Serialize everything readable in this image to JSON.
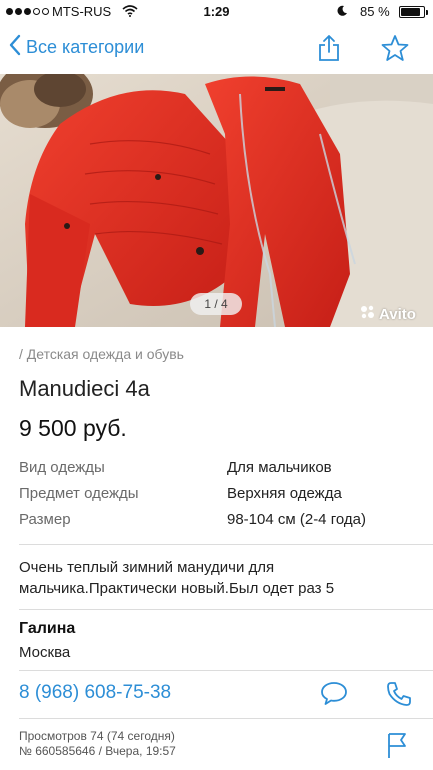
{
  "status_bar": {
    "carrier": "MTS-RUS",
    "time": "1:29",
    "battery": "85 %",
    "battery_level": 0.85,
    "signal_bars": 3,
    "icons": [
      "signal-dots",
      "wifi-icon",
      "moon-icon",
      "battery-icon"
    ]
  },
  "nav": {
    "back_label": "Все категории",
    "accent_color": "#2d8ed6",
    "icons": [
      "chevron-left-icon",
      "share-icon",
      "star-icon"
    ]
  },
  "photo": {
    "counter": "1 / 4",
    "watermark": "Avito"
  },
  "listing": {
    "category": "/ Детская одежда и обувь",
    "title": "Manudieci 4а",
    "price": "9 500 руб.",
    "params": [
      {
        "label": "Вид одежды",
        "value": "Для мальчиков"
      },
      {
        "label": "Предмет одежды",
        "value": "Верхняя одежда"
      },
      {
        "label": "Размер",
        "value": "98-104 см (2-4 года)"
      }
    ],
    "description_line1": "Очень теплый зимний манудичи для",
    "description_line2": "мальчика.Практически новый.Был одет раз 5"
  },
  "seller": {
    "name": "Галина",
    "city": "Москва",
    "phone": "8 (968) 608-75-38"
  },
  "stats": {
    "views": "Просмотров 74 (74 сегодня)",
    "ad_info": "№ 660585646 / Вчера, 19:57"
  }
}
